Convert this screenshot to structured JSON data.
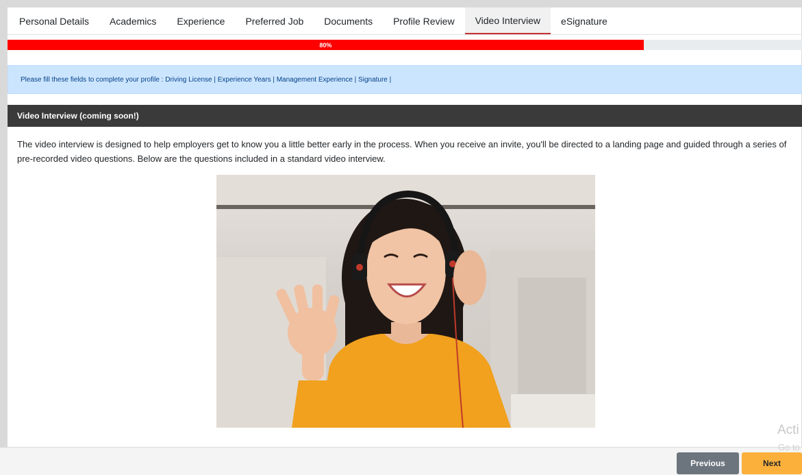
{
  "tabs": [
    {
      "label": "Personal Details",
      "active": false
    },
    {
      "label": "Academics",
      "active": false
    },
    {
      "label": "Experience",
      "active": false
    },
    {
      "label": "Preferred Job",
      "active": false
    },
    {
      "label": "Documents",
      "active": false
    },
    {
      "label": "Profile Review",
      "active": false
    },
    {
      "label": "Video Interview",
      "active": true
    },
    {
      "label": "eSignature",
      "active": false
    }
  ],
  "progress": {
    "label": "80%",
    "fraction": 0.8,
    "color": "#ff0000"
  },
  "alert": {
    "text": "Please fill these fields to complete your profile : Driving License | Experience Years | Management Experience | Signature |"
  },
  "section": {
    "title": "Video Interview (coming soon!)",
    "description": "The video interview is designed to help employers get to know you a little better early in the process. When you receive an invite, you'll be directed to a landing page and guided through a series of pre-recorded video questions. Below are the questions included in a standard video interview."
  },
  "image": {
    "name": "woman-waving-with-headphones"
  },
  "buttons": {
    "previous": "Previous",
    "next": "Next"
  },
  "watermark": {
    "line1": "Acti",
    "line2": "Go to"
  },
  "colors": {
    "accent_tab": "#c53030",
    "next_button": "#fbb03b",
    "prev_button": "#6c757d",
    "header_bg": "#3a3a3a"
  }
}
